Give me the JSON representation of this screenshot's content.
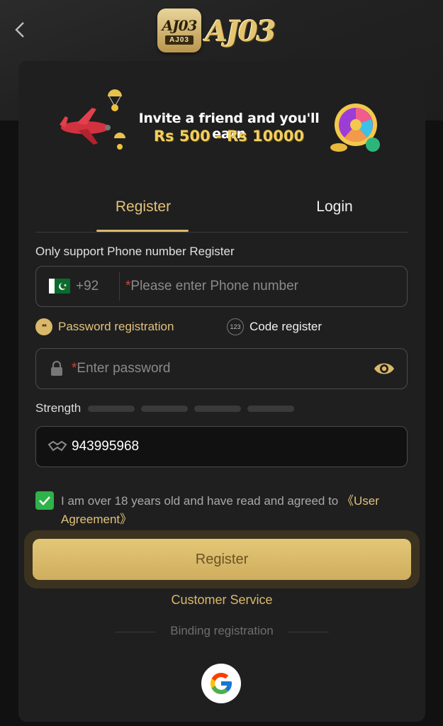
{
  "header": {
    "back_icon": "chevron-left-icon",
    "logo_app_text": "AJ03",
    "logo_app_subtext": "AJ03",
    "logo_brand_text": "AJ03"
  },
  "banner": {
    "line1": "Invite a friend and you'll earn",
    "line2": "Rs 500 - Rs 10000"
  },
  "tabs": [
    {
      "label": "Register",
      "active": true
    },
    {
      "label": "Login",
      "active": false
    }
  ],
  "form": {
    "note": "Only support Phone number Register",
    "country_code": "+92",
    "phone_required_mark": "*",
    "phone_placeholder": "Please enter Phone number",
    "mode_password_label": "Password registration",
    "mode_password_icon_text": "**",
    "mode_code_label": "Code register",
    "mode_code_icon_text": "123",
    "password_required_mark": "*",
    "password_placeholder": "Enter password",
    "strength_label": "Strength",
    "invite_code_value": "943995968",
    "agree_text": "I am over 18 years old and have read and agreed to ",
    "agree_link": "《User Agreement》",
    "agree_checked": true
  },
  "actions": {
    "register_label": "Register",
    "customer_service_label": "Customer Service",
    "binding_label": "Binding registration"
  },
  "colors": {
    "accent_gold": "#d9b86a",
    "checkbox_green": "#2fb24a",
    "required_red": "#d0453c"
  }
}
